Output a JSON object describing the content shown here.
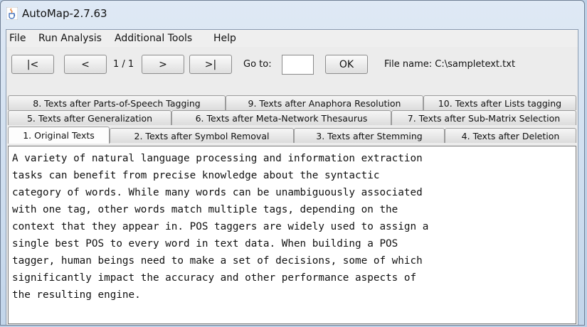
{
  "window": {
    "title": "AutoMap-2.7.63",
    "icon": "java-cup-icon"
  },
  "menu": [
    "File",
    "Run Analysis",
    "Additional Tools",
    "Help"
  ],
  "toolbar": {
    "first_label": "|<",
    "prev_label": "<",
    "page_indicator": "1 / 1",
    "next_label": ">",
    "last_label": ">|",
    "goto_label": "Go to:",
    "goto_value": "",
    "ok_label": "OK",
    "file_name": "File name: C:\\sampletext.txt"
  },
  "tabs": {
    "row1": [
      "8. Texts after Parts-of-Speech Tagging",
      "9. Texts after Anaphora Resolution",
      "10. Texts after Lists tagging"
    ],
    "row2": [
      "5. Texts after Generalization",
      "6. Texts after Meta-Network Thesaurus",
      "7. Texts after Sub-Matrix Selection"
    ],
    "row3": [
      "1. Original Texts",
      "2. Texts after Symbol Removal",
      "3. Texts after Stemming",
      "4. Texts after Deletion"
    ],
    "active": "1. Original Texts"
  },
  "content": {
    "lines": [
      "A variety of natural language processing and information extraction",
      "tasks can benefit from precise knowledge about the syntactic",
      "category of words. While many words can be unambiguously associated",
      "with one tag, other words match multiple tags, depending on the",
      "context that they appear in. POS taggers are widely used to assign a",
      "single best POS to every word in text data. When building a POS",
      "tagger, human beings need to make a set of decisions, some of which",
      "significantly impact the accuracy and other performance aspects of",
      "the resulting engine."
    ]
  }
}
